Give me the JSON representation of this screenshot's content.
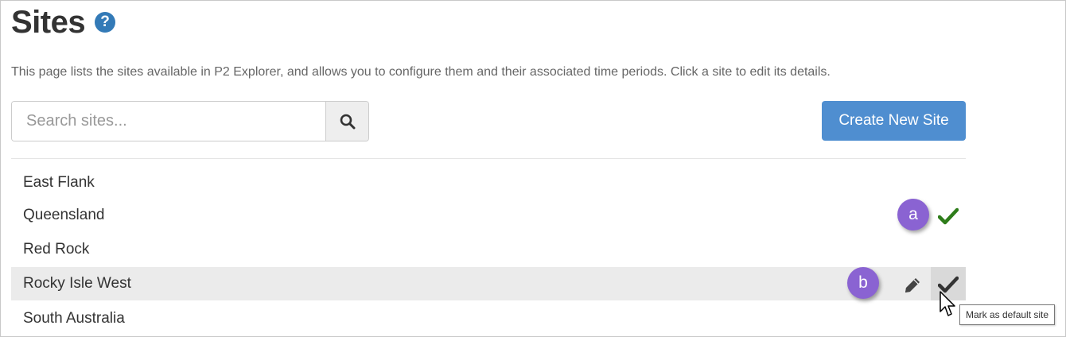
{
  "page": {
    "title": "Sites",
    "description": "This page lists the sites available in P2 Explorer, and allows you to configure them and their associated time periods. Click a site to edit its details."
  },
  "search": {
    "placeholder": "Search sites..."
  },
  "toolbar": {
    "create_label": "Create New Site"
  },
  "sites": [
    {
      "name": "East Flank"
    },
    {
      "name": "Queensland",
      "is_default": true
    },
    {
      "name": "Red Rock"
    },
    {
      "name": "Rocky Isle West",
      "hovered": true
    },
    {
      "name": "South Australia"
    }
  ],
  "callouts": {
    "a": "a",
    "b": "b"
  },
  "tooltip": {
    "text": "Mark as default site"
  },
  "icons": {
    "help": "question-circle-icon",
    "search": "search-icon",
    "default": "check-icon",
    "edit": "pencil-icon",
    "cursor": "mouse-pointer-icon"
  },
  "colors": {
    "primary": "#4f8ed0",
    "help_icon": "#337ab7",
    "default_check": "#2e7d1a",
    "callout": "#8a63d2",
    "row_hover": "#ebebeb"
  }
}
